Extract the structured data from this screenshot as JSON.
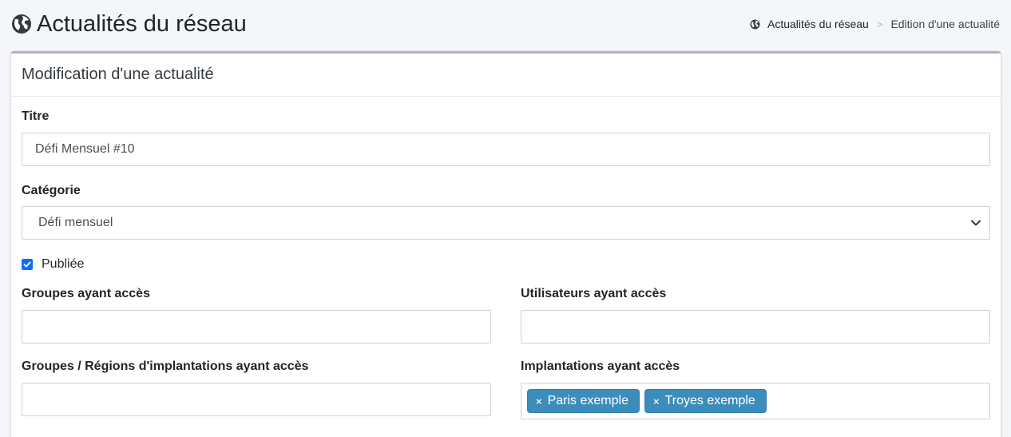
{
  "header": {
    "title": "Actualités du réseau",
    "breadcrumb": [
      {
        "label": "Actualités du réseau",
        "icon": "globe-icon"
      },
      {
        "label": "Edition d'une actualité"
      }
    ],
    "breadcrumb_separator": ">"
  },
  "card": {
    "title": "Modification d'une actualité"
  },
  "form": {
    "titre": {
      "label": "Titre",
      "value": "Défi Mensuel #10"
    },
    "categorie": {
      "label": "Catégorie",
      "value": "Défi mensuel"
    },
    "publiee": {
      "label": "Publiée",
      "checked": true
    },
    "groupes": {
      "label": "Groupes ayant accès",
      "value": ""
    },
    "utilisateurs": {
      "label": "Utilisateurs ayant accès",
      "value": ""
    },
    "groupes_regions": {
      "label": "Groupes / Régions d'implantations ayant accès",
      "value": ""
    },
    "implantations": {
      "label": "Implantations ayant accès",
      "tags": [
        "Paris exemple",
        "Troyes exemple"
      ],
      "remove_symbol": "×"
    }
  },
  "colors": {
    "tag_bg": "#3c8dbc",
    "checkbox": "#0b6efd",
    "page_bg": "#f4f6f9"
  }
}
